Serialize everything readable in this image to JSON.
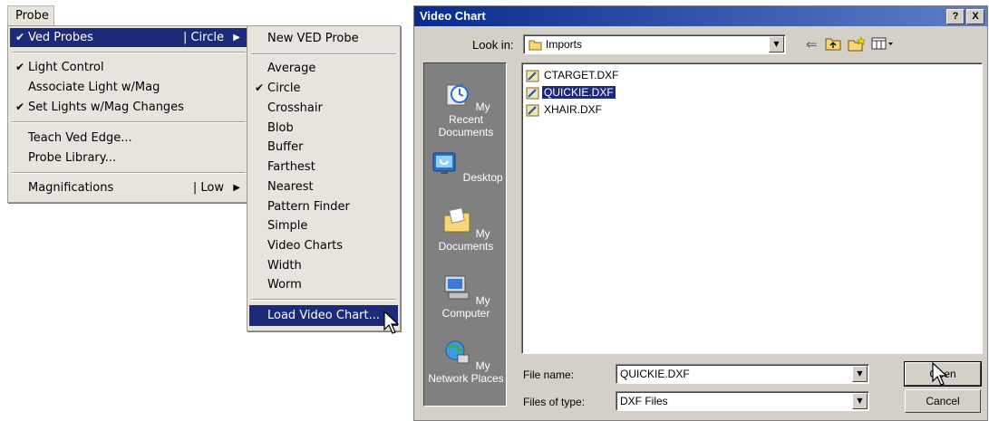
{
  "left": {
    "menubar_label": "Probe",
    "menu1": {
      "items": [
        {
          "label": "Ved Probes",
          "sub": "| Circle",
          "checked": true
        },
        {
          "label": "Light Control",
          "checked": true
        },
        {
          "label": "Associate Light w/Mag",
          "checked": false
        },
        {
          "label": "Set Lights w/Mag Changes",
          "checked": true
        },
        {
          "label": "Teach Ved Edge...",
          "checked": false
        },
        {
          "label": "Probe Library...",
          "checked": false
        },
        {
          "label": "Magnifications",
          "sub": "| Low",
          "checked": false
        }
      ]
    },
    "menu2": {
      "items": [
        {
          "label": "New VED Probe"
        },
        {
          "label": "Average"
        },
        {
          "label": "Circle",
          "checked": true
        },
        {
          "label": "Crosshair"
        },
        {
          "label": "Blob"
        },
        {
          "label": "Buffer"
        },
        {
          "label": "Farthest"
        },
        {
          "label": "Nearest"
        },
        {
          "label": "Pattern Finder"
        },
        {
          "label": "Simple"
        },
        {
          "label": "Video Charts"
        },
        {
          "label": "Width"
        },
        {
          "label": "Worm"
        },
        {
          "label": "Load Video Chart..."
        }
      ]
    },
    "glyphs": {
      "check": "✔",
      "submenu_arrow": "▶"
    }
  },
  "dialog": {
    "title": "Video Chart",
    "title_buttons": {
      "help": "?",
      "close": "X"
    },
    "look_in_label": "Look in:",
    "look_in_value": "Imports",
    "places": [
      {
        "label": "My Recent Documents",
        "icon": "recent-documents-icon"
      },
      {
        "label": "Desktop",
        "icon": "desktop-icon"
      },
      {
        "label": "My Documents",
        "icon": "my-documents-icon"
      },
      {
        "label": "My Computer",
        "icon": "my-computer-icon"
      },
      {
        "label": "My Network Places",
        "icon": "network-places-icon"
      }
    ],
    "files": [
      {
        "name": "CTARGET.DXF",
        "selected": false
      },
      {
        "name": "QUICKIE.DXF",
        "selected": true
      },
      {
        "name": "XHAIR.DXF",
        "selected": false
      }
    ],
    "file_name_label": "File name:",
    "file_name_value": "QUICKIE.DXF",
    "files_of_type_label": "Files of type:",
    "files_of_type_value": "DXF Files",
    "open_label": "Open",
    "cancel_label": "Cancel",
    "toolbar_glyphs": {
      "back": "⇐",
      "up": "⬑",
      "new_folder": "✱",
      "views": "▦▾"
    },
    "dropdown_glyph": "▼"
  },
  "colors": {
    "highlight": "#1d2a7a",
    "title_start": "#0a2a8c",
    "title_end": "#5d7fc9",
    "places_bg": "#808080"
  }
}
